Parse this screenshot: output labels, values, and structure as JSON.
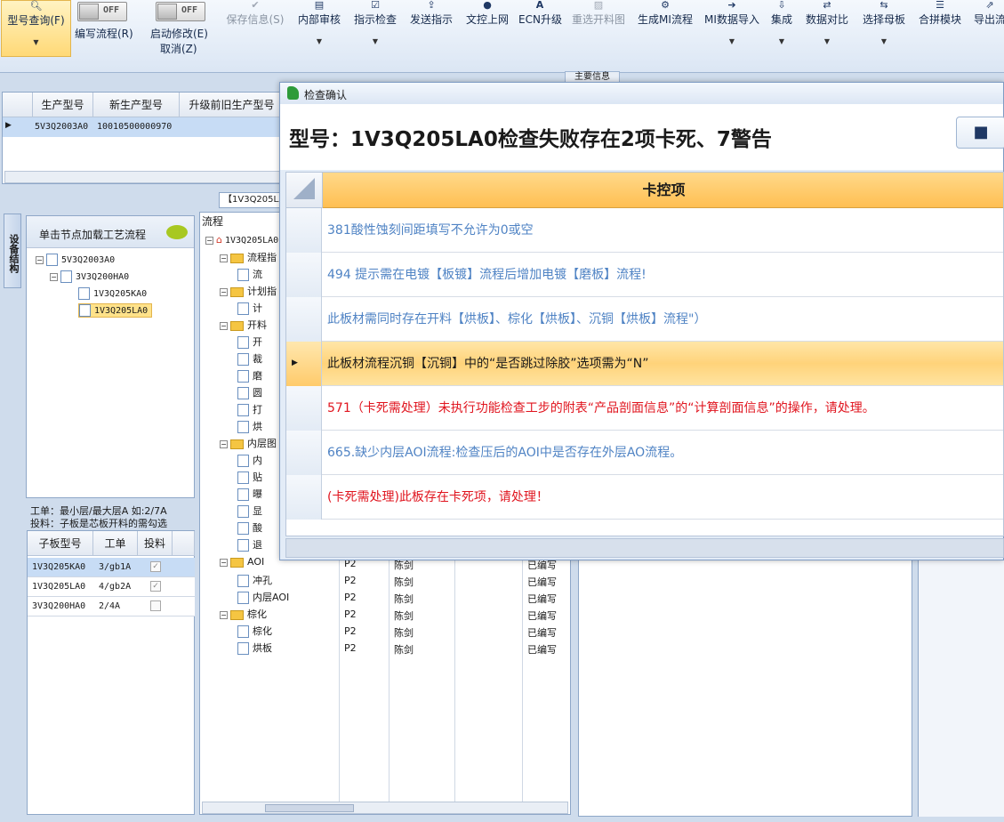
{
  "ribbon": {
    "buttons": [
      {
        "id": "query",
        "label": "型号查询(F)",
        "icon": "search-icon",
        "state": "active"
      },
      {
        "id": "save",
        "label": "保存信息(S)",
        "icon": "check-icon",
        "state": "disabled"
      },
      {
        "id": "audit",
        "label": "内部审核",
        "icon": "printer-icon",
        "state": "normal"
      },
      {
        "id": "check",
        "label": "指示检查",
        "icon": "checklist-icon",
        "state": "normal"
      },
      {
        "id": "send",
        "label": "发送指示",
        "icon": "upload-icon",
        "state": "normal"
      },
      {
        "id": "publish",
        "label": "文控上网",
        "icon": "people-icon",
        "state": "normal"
      },
      {
        "id": "ecn",
        "label": "ECN升级",
        "icon": "letter-a-icon",
        "state": "normal"
      },
      {
        "id": "reselect",
        "label": "重选开料图",
        "icon": "image-icon",
        "state": "disabled"
      },
      {
        "id": "gen",
        "label": "生成MI流程",
        "icon": "gears-icon",
        "state": "normal"
      },
      {
        "id": "import",
        "label": "MI数据导入",
        "icon": "import-icon",
        "state": "normal"
      },
      {
        "id": "integrate",
        "label": "集成",
        "icon": "download-icon",
        "state": "normal"
      },
      {
        "id": "compare",
        "label": "数据对比",
        "icon": "compare-icon",
        "state": "normal"
      },
      {
        "id": "mother",
        "label": "选择母板",
        "icon": "select-icon",
        "state": "normal"
      },
      {
        "id": "merge",
        "label": "合拼模块",
        "icon": "list-icon",
        "state": "normal"
      },
      {
        "id": "export",
        "label": "导出流",
        "icon": "export-icon",
        "state": "normal"
      }
    ],
    "toggles": [
      {
        "label": "编写流程(R)",
        "value": "OFF"
      },
      {
        "label": "启动修改(E)",
        "value": "OFF",
        "sub": "取消(Z)"
      }
    ],
    "section_tab": "主要信息"
  },
  "top_grid": {
    "columns": [
      "生产型号",
      "新生产型号",
      "升级前旧生产型号"
    ],
    "rows": [
      [
        "5V3Q2003A0",
        "10010500000970",
        ""
      ]
    ]
  },
  "left_panel": {
    "vertical_tab": "设备结构",
    "header": "单击节点加载工艺流程",
    "tree": [
      "5V3Q2003A0",
      "3V3Q200HA0",
      "1V3Q205KA0",
      "1V3Q205LA0"
    ],
    "info_line1": "工单：最小层/最大层A 如:2/7A",
    "info_line2": "投料：子板是芯板开料的需勾选",
    "sub_grid": {
      "columns": [
        "子板型号",
        "工单",
        "投料"
      ],
      "rows": [
        {
          "model": "1V3Q205KA0",
          "order": "3/gb1A",
          "checked": true
        },
        {
          "model": "1V3Q205LA0",
          "order": "4/gb2A",
          "checked": true
        },
        {
          "model": "3V3Q200HA0",
          "order": "2/4A",
          "checked": false
        }
      ]
    }
  },
  "flow_panel": {
    "tab_label": "【1V3Q205LA0",
    "header": "流程",
    "root": "1V3Q205LA0",
    "tree": [
      {
        "type": "folder",
        "label": "流程指",
        "indent": 1
      },
      {
        "type": "file",
        "label": "流",
        "indent": 2
      },
      {
        "type": "folder",
        "label": "计划指",
        "indent": 1
      },
      {
        "type": "file",
        "label": "计",
        "indent": 2
      },
      {
        "type": "folder",
        "label": "开料",
        "indent": 1
      },
      {
        "type": "file",
        "label": "开",
        "indent": 2
      },
      {
        "type": "file",
        "label": "裁",
        "indent": 2
      },
      {
        "type": "file",
        "label": "磨",
        "indent": 2
      },
      {
        "type": "file",
        "label": "圆",
        "indent": 2
      },
      {
        "type": "file",
        "label": "打",
        "indent": 2
      },
      {
        "type": "file",
        "label": "烘",
        "indent": 2
      },
      {
        "type": "folder",
        "label": "内层图",
        "indent": 1
      },
      {
        "type": "file",
        "label": "内",
        "indent": 2
      },
      {
        "type": "file",
        "label": "贴",
        "indent": 2
      },
      {
        "type": "file",
        "label": "曝",
        "indent": 2
      },
      {
        "type": "file",
        "label": "显",
        "indent": 2
      },
      {
        "type": "file",
        "label": "酸",
        "indent": 2
      },
      {
        "type": "file",
        "label": "退",
        "indent": 2
      }
    ],
    "rows_below": [
      {
        "type": "folder",
        "label": "AOI",
        "indent": 1,
        "layer": "P2",
        "person": "陈剑",
        "status": "已编写"
      },
      {
        "type": "file",
        "label": "冲孔",
        "indent": 2,
        "layer": "P2",
        "person": "陈剑",
        "status": "已编写"
      },
      {
        "type": "file",
        "label": "内层AOI",
        "indent": 2,
        "layer": "P2",
        "person": "陈剑",
        "status": "已编写"
      },
      {
        "type": "folder",
        "label": "棕化",
        "indent": 1,
        "layer": "P2",
        "person": "陈剑",
        "status": "已编写"
      },
      {
        "type": "file",
        "label": "棕化",
        "indent": 2,
        "layer": "P2",
        "person": "陈剑",
        "status": "已编写"
      },
      {
        "type": "file",
        "label": "烘板",
        "indent": 2,
        "layer": "P2",
        "person": "陈剑",
        "status": "已编写"
      }
    ]
  },
  "dialog": {
    "title": "检查确认",
    "heading": "型号：1V3Q205LA0检查失败存在2项卡死、7警告",
    "column_header": "卡控项",
    "items": [
      {
        "text": "381酸性蚀刻间距填写不允许为0或空",
        "level": "warning"
      },
      {
        "text": "494 提示需在电镀【板镀】流程后增加电镀【磨板】流程!",
        "level": "warning"
      },
      {
        "text": "此板材需同时存在开料【烘板】、棕化【烘板】、沉铜【烘板】流程\"）",
        "level": "warning"
      },
      {
        "text": "此板材流程沉铜【沉铜】中的“是否跳过除胶”选项需为“N”",
        "level": "selected"
      },
      {
        "text": "571（卡死需处理）未执行功能检查工步的附表“产品剖面信息”的“计算剖面信息”的操作，请处理。",
        "level": "error"
      },
      {
        "text": "665.缺少内层AOI流程:检查压后的AOI中是否存在外层AO流程。",
        "level": "warning"
      },
      {
        "text": "(卡死需处理)此板存在卡死项，请处理！",
        "level": "error"
      }
    ],
    "colors": {
      "warning": "#4f83c4",
      "error": "#e0141e",
      "selected": "#1a1a1a",
      "header": "#ffc766"
    }
  }
}
